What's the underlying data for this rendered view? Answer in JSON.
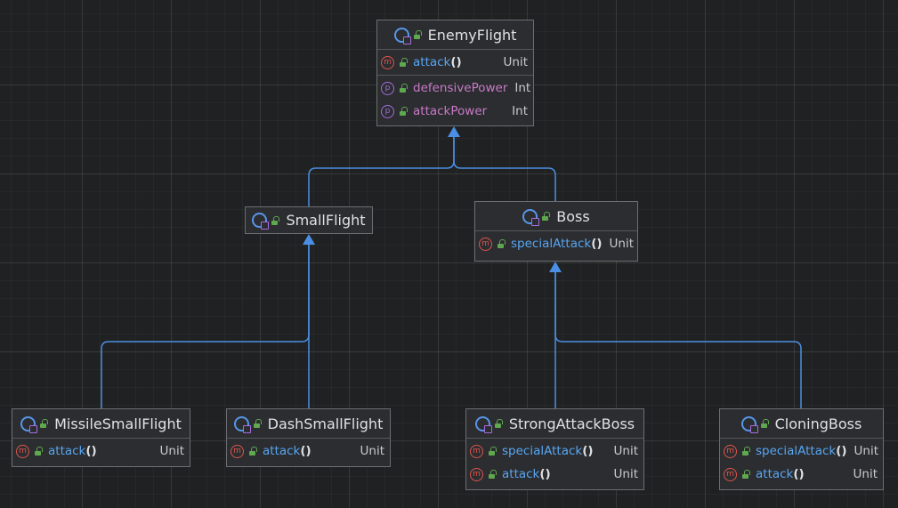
{
  "diagram": {
    "classes": {
      "enemy_flight": {
        "name": "EnemyFlight",
        "methods": [
          {
            "name": "attack",
            "parens": "()",
            "type": "Unit"
          }
        ],
        "properties": [
          {
            "name": "defensivePower",
            "type": "Int"
          },
          {
            "name": "attackPower",
            "type": "Int"
          }
        ]
      },
      "small_flight": {
        "name": "SmallFlight"
      },
      "boss": {
        "name": "Boss",
        "methods": [
          {
            "name": "specialAttack",
            "parens": "()",
            "type": "Unit"
          }
        ]
      },
      "missile_small_flight": {
        "name": "MissileSmallFlight",
        "methods": [
          {
            "name": "attack",
            "parens": "()",
            "type": "Unit"
          }
        ]
      },
      "dash_small_flight": {
        "name": "DashSmallFlight",
        "methods": [
          {
            "name": "attack",
            "parens": "()",
            "type": "Unit"
          }
        ]
      },
      "strong_attack_boss": {
        "name": "StrongAttackBoss",
        "methods": [
          {
            "name": "specialAttack",
            "parens": "()",
            "type": "Unit"
          },
          {
            "name": "attack",
            "parens": "()",
            "type": "Unit"
          }
        ]
      },
      "cloning_boss": {
        "name": "CloningBoss",
        "methods": [
          {
            "name": "specialAttack",
            "parens": "()",
            "type": "Unit"
          },
          {
            "name": "attack",
            "parens": "()",
            "type": "Unit"
          }
        ]
      }
    },
    "inheritance": [
      {
        "child": "SmallFlight",
        "parent": "EnemyFlight"
      },
      {
        "child": "Boss",
        "parent": "EnemyFlight"
      },
      {
        "child": "MissileSmallFlight",
        "parent": "SmallFlight"
      },
      {
        "child": "DashSmallFlight",
        "parent": "SmallFlight"
      },
      {
        "child": "StrongAttackBoss",
        "parent": "Boss"
      },
      {
        "child": "CloningBoss",
        "parent": "Boss"
      }
    ],
    "icons": {
      "class": "class-icon",
      "method": "method-icon",
      "property": "property-icon",
      "visibility": "public-lock-icon"
    },
    "colors": {
      "background": "#202122",
      "node_fill": "#2b2d30",
      "node_border": "#6b6d70",
      "edge": "#4a8fe3",
      "method_name": "#58a6f2",
      "property_name": "#c97ac7",
      "method_icon": "#e0554d",
      "property_icon": "#a86de0",
      "class_icon": "#5796e8",
      "lock_icon": "#5fa84f"
    }
  }
}
